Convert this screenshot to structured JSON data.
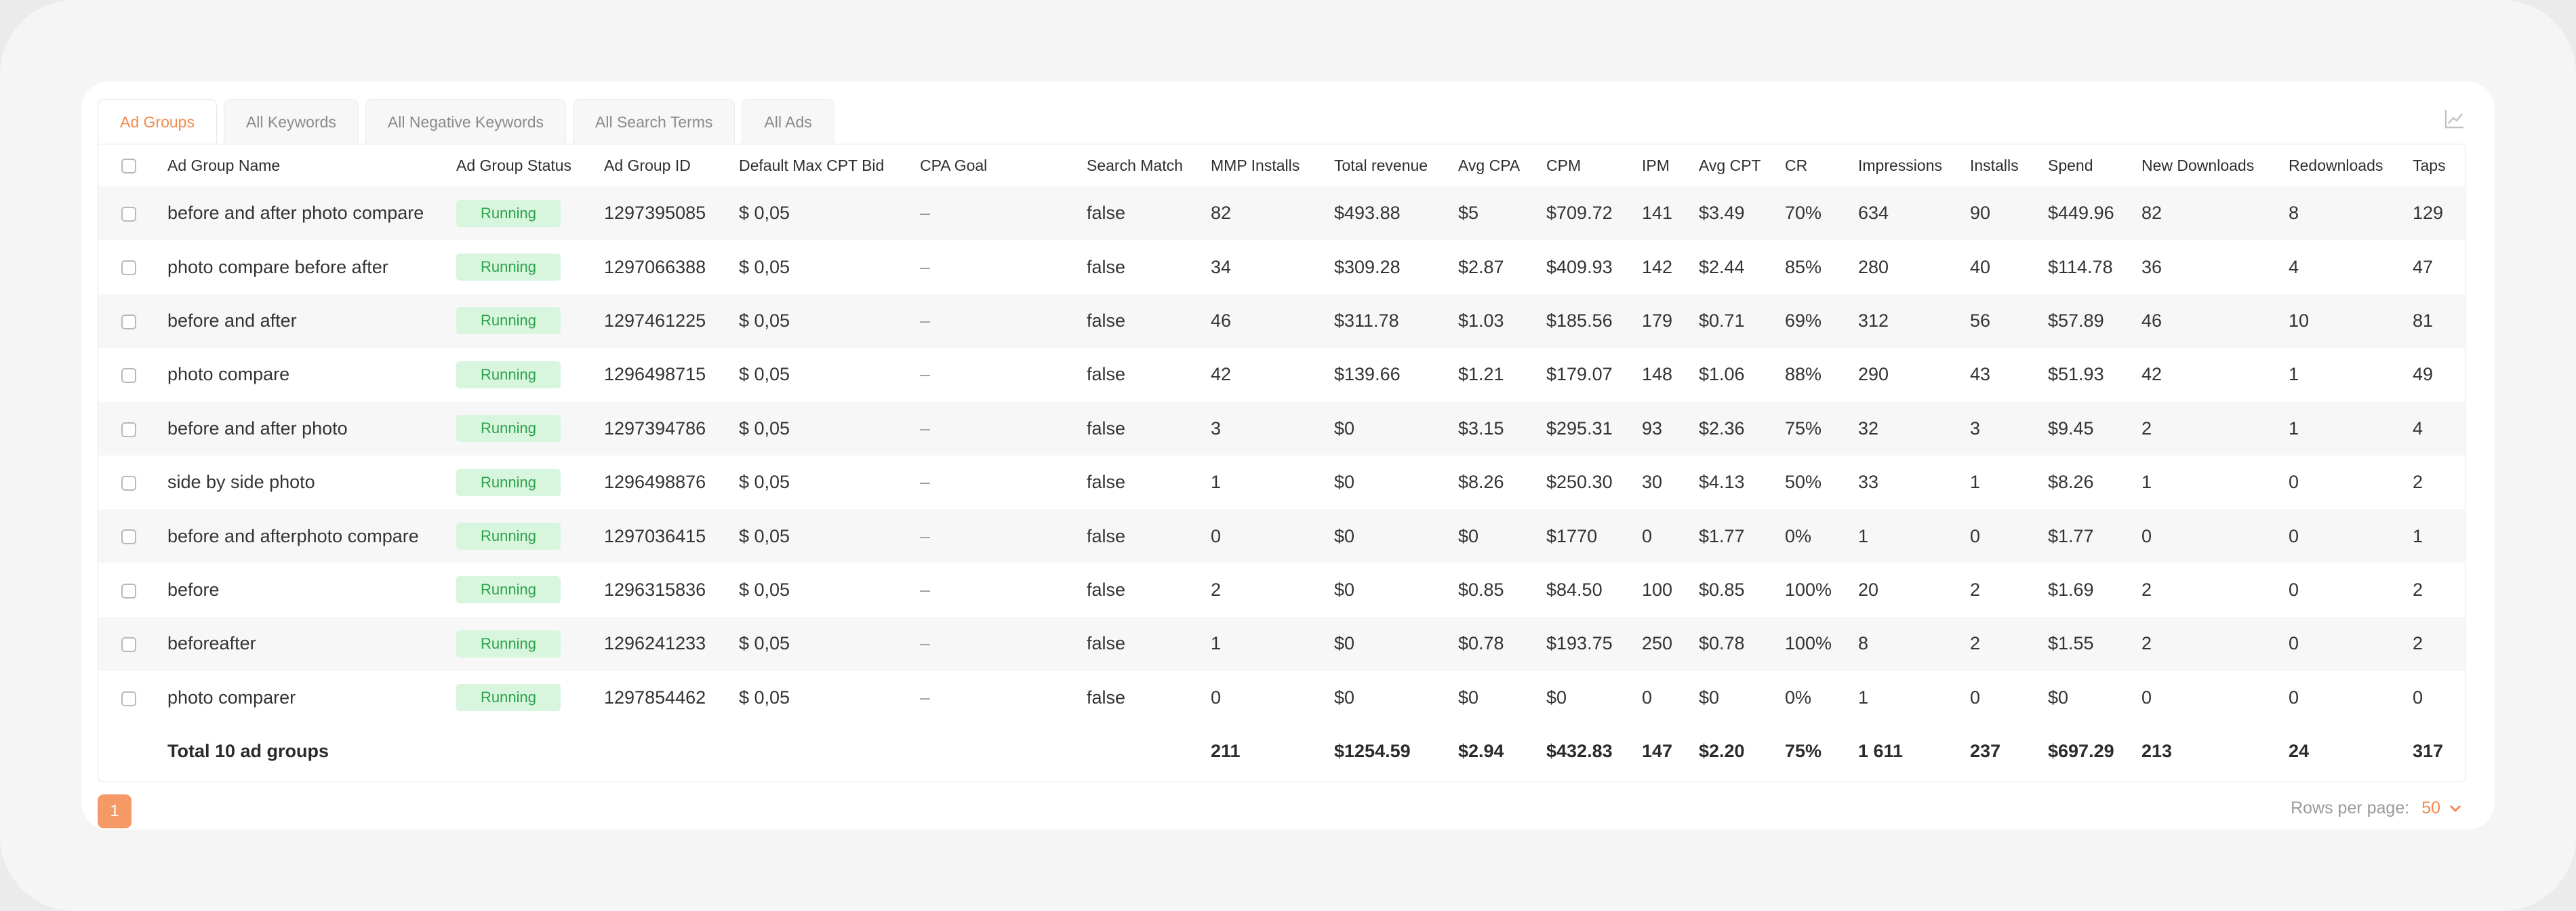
{
  "tabs": [
    "Ad Groups",
    "All Keywords",
    "All Negative Keywords",
    "All Search Terms",
    "All Ads"
  ],
  "columns": [
    "Ad Group Name",
    "Ad Group Status",
    "Ad Group ID",
    "Default Max CPT Bid",
    "CPA Goal",
    "Search Match",
    "MMP Installs",
    "Total revenue",
    "Avg CPA",
    "CPM",
    "IPM",
    "Avg CPT",
    "CR",
    "Impressions",
    "Installs",
    "Spend",
    "New Downloads",
    "Redownloads",
    "Taps"
  ],
  "rows": [
    [
      "before and after photo compare",
      "Running",
      "1297395085",
      "$ 0,05",
      "–",
      "false",
      "82",
      "$493.88",
      "$5",
      "$709.72",
      "141",
      "$3.49",
      "70%",
      "634",
      "90",
      "$449.96",
      "82",
      "8",
      "129"
    ],
    [
      "photo compare before after",
      "Running",
      "1297066388",
      "$ 0,05",
      "–",
      "false",
      "34",
      "$309.28",
      "$2.87",
      "$409.93",
      "142",
      "$2.44",
      "85%",
      "280",
      "40",
      "$114.78",
      "36",
      "4",
      "47"
    ],
    [
      "before and after",
      "Running",
      "1297461225",
      "$ 0,05",
      "–",
      "false",
      "46",
      "$311.78",
      "$1.03",
      "$185.56",
      "179",
      "$0.71",
      "69%",
      "312",
      "56",
      "$57.89",
      "46",
      "10",
      "81"
    ],
    [
      "photo compare",
      "Running",
      "1296498715",
      "$ 0,05",
      "–",
      "false",
      "42",
      "$139.66",
      "$1.21",
      "$179.07",
      "148",
      "$1.06",
      "88%",
      "290",
      "43",
      "$51.93",
      "42",
      "1",
      "49"
    ],
    [
      "before and after photo",
      "Running",
      "1297394786",
      "$ 0,05",
      "–",
      "false",
      "3",
      "$0",
      "$3.15",
      "$295.31",
      "93",
      "$2.36",
      "75%",
      "32",
      "3",
      "$9.45",
      "2",
      "1",
      "4"
    ],
    [
      "side by side photo",
      "Running",
      "1296498876",
      "$ 0,05",
      "–",
      "false",
      "1",
      "$0",
      "$8.26",
      "$250.30",
      "30",
      "$4.13",
      "50%",
      "33",
      "1",
      "$8.26",
      "1",
      "0",
      "2"
    ],
    [
      "before and afterphoto compare",
      "Running",
      "1297036415",
      "$ 0,05",
      "–",
      "false",
      "0",
      "$0",
      "$0",
      "$1770",
      "0",
      "$1.77",
      "0%",
      "1",
      "0",
      "$1.77",
      "0",
      "0",
      "1"
    ],
    [
      "before",
      "Running",
      "1296315836",
      "$ 0,05",
      "–",
      "false",
      "2",
      "$0",
      "$0.85",
      "$84.50",
      "100",
      "$0.85",
      "100%",
      "20",
      "2",
      "$1.69",
      "2",
      "0",
      "2"
    ],
    [
      "beforeafter",
      "Running",
      "1296241233",
      "$ 0,05",
      "–",
      "false",
      "1",
      "$0",
      "$0.78",
      "$193.75",
      "250",
      "$0.78",
      "100%",
      "8",
      "2",
      "$1.55",
      "2",
      "0",
      "2"
    ],
    [
      "photo comparer",
      "Running",
      "1297854462",
      "$ 0,05",
      "–",
      "false",
      "0",
      "$0",
      "$0",
      "$0",
      "0",
      "$0",
      "0%",
      "1",
      "0",
      "$0",
      "0",
      "0",
      "0"
    ]
  ],
  "totals": [
    "Total 10 ad groups",
    "",
    "",
    "",
    "",
    "",
    "211",
    "$1254.59",
    "$2.94",
    "$432.83",
    "147",
    "$2.20",
    "75%",
    "1 611",
    "237",
    "$697.29",
    "213",
    "24",
    "317"
  ],
  "pagination": {
    "current_page": "1",
    "rows_per_page_label": "Rows per page:",
    "rows_per_page_value": "50"
  },
  "colors": {
    "accent": "#f28a4c",
    "running_bg": "#d8f5dd",
    "running_text": "#2aa34a"
  }
}
